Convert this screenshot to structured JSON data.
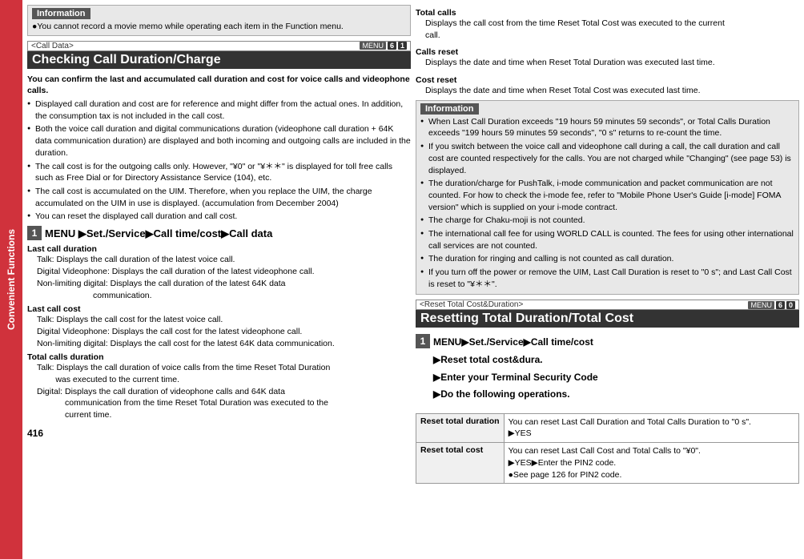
{
  "sidebar": {
    "label": "Convenient Functions"
  },
  "page_number": "416",
  "left": {
    "info_box": {
      "header": "Information",
      "text": "●You cannot record a movie memo while operating each item in the Function menu."
    },
    "section": {
      "tag": "&lt;Call Data&gt;",
      "menu_icon": "MENU",
      "menu_num1": "6",
      "menu_num2": "1",
      "title": "Checking Call Duration/Charge",
      "intro_bold": "You can confirm the last and accumulated call duration and cost for voice calls and videophone calls.",
      "bullets": [
        "Displayed call duration and cost are for reference and might differ from the actual ones. In addition, the consumption tax is not included in the call cost.",
        "Both the voice call duration and digital communications duration (videophone call duration + 64K data communication duration) are displayed and both incoming and outgoing calls are included in the duration.",
        "The call cost is for the outgoing calls only. However, \"¥0\" or \"¥＊＊\" is displayed for toll free calls such as Free Dial or for Directory Assistance Service (104), etc.",
        "The call cost is accumulated on the UIM. Therefore, when you replace the UIM, the charge accumulated on the UIM in use is displayed. (accumulation from December 2004)",
        "You can reset the displayed call duration and call cost."
      ],
      "step1": {
        "num": "1",
        "text": "MENU ▶Set./Service▶Call time/cost▶Call data"
      },
      "sub_sections": [
        {
          "label": "Last call duration",
          "lines": [
            "Talk: Displays the call duration of the latest voice call.",
            "Digital Videophone: Displays the call duration of the latest videophone call.",
            "Non-limiting digital: Displays the call duration of the latest 64K data communication."
          ]
        },
        {
          "label": "Last call cost",
          "lines": [
            "Talk: Displays the call cost for the latest voice call.",
            "Digital Videophone: Displays the call cost for the latest videophone call.",
            "Non-limiting digital: Displays the call cost for the latest 64K data communication."
          ]
        },
        {
          "label": "Total calls duration",
          "lines": [
            "Talk: Displays the call duration of voice calls from the time Reset Total Duration was executed to the current time.",
            "Digital: Displays the call duration of videophone calls and 64K data communication from the time Reset Total Duration was executed to the current time."
          ]
        }
      ]
    }
  },
  "right": {
    "sub_sections_continued": [
      {
        "label": "Total calls",
        "lines": [
          "Displays the call cost from the time Reset Total Cost was executed to the current call."
        ]
      },
      {
        "label": "Calls reset",
        "lines": [
          "Displays the date and time when Reset Total Duration was executed last time."
        ]
      },
      {
        "label": "Cost reset",
        "lines": [
          "Displays the date and time when Reset Total Cost was executed last time."
        ]
      }
    ],
    "info_box": {
      "header": "Information",
      "bullets": [
        "When Last Call Duration exceeds \"19 hours 59 minutes 59 seconds\", or Total Calls Duration exceeds \"199 hours 59 minutes 59 seconds\", \"0 s\" returns to re-count the time.",
        "If you switch between the voice call and videophone call during a call, the call duration and call cost are counted respectively for the calls. You are not charged while \"Changing\" (see page 53) is displayed.",
        "The duration/charge for PushTalk, i-mode communication and packet communication are not counted. For how to check the i-mode fee, refer to \"Mobile Phone User's Guide [i-mode] FOMA version\" which is supplied on your i-mode contract.",
        "The charge for Chaku-moji is not counted.",
        "The international call fee for using WORLD CALL is counted. The fees for using other international call services are not counted.",
        "The duration for ringing and calling is not counted as call duration.",
        "If you turn off the power or remove the UIM, Last Call Duration is reset to \"0 s\"; and Last Call Cost is reset to \"¥＊＊\"."
      ]
    },
    "section2": {
      "tag": "&lt;Reset Total Cost&Duration&gt;",
      "menu_icon": "MENU",
      "menu_num1": "6",
      "menu_num2": "0",
      "title": "Resetting Total Duration/Total Cost",
      "step1": {
        "num": "1",
        "lines": [
          "MENU ▶Set./Service▶Call time/cost",
          "▶Reset total cost&dura.",
          "▶Enter your Terminal Security Code",
          "▶Do the following operations."
        ]
      },
      "table": [
        {
          "label": "Reset total duration",
          "content": "You can reset Last Call Duration and Total Calls Duration to \"0 s\".\n▶YES"
        },
        {
          "label": "Reset total cost",
          "content": "You can reset Last Call Cost and Total Calls to \"¥0\".\n▶YES▶Enter the PIN2 code.\n●See page 126 for PIN2 code."
        }
      ]
    }
  }
}
